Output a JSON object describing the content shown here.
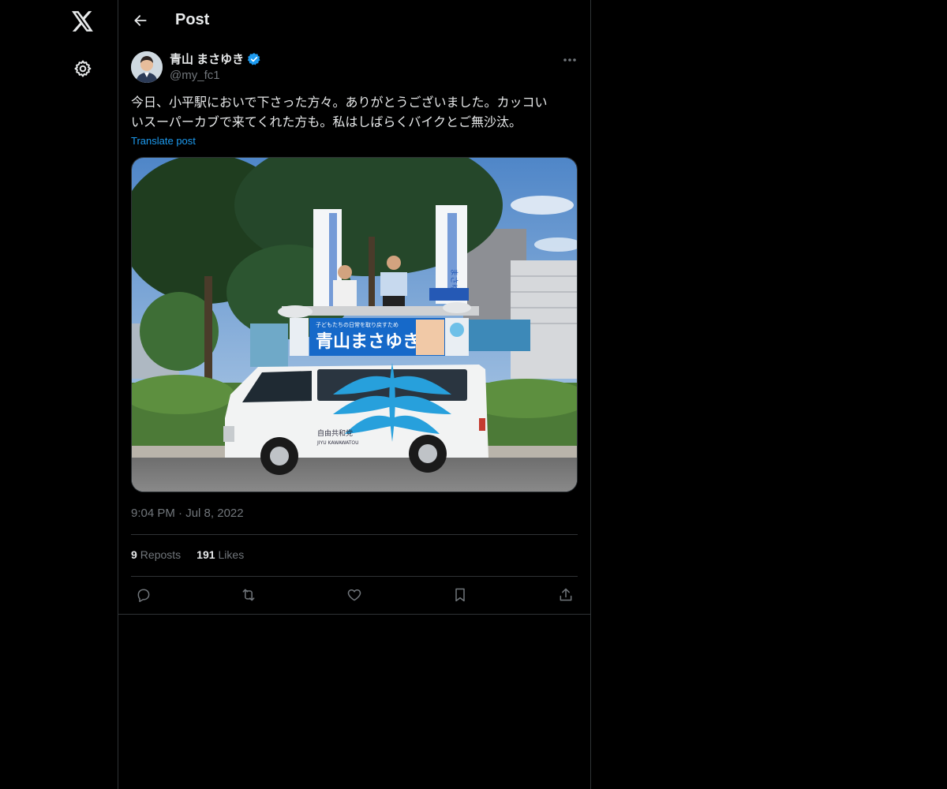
{
  "nav": {
    "items": [
      {
        "icon": "x-logo-icon"
      },
      {
        "icon": "gear-icon"
      }
    ]
  },
  "header": {
    "title": "Post",
    "back_icon": "arrow-left-icon"
  },
  "post": {
    "author_name": "青山 まさゆき",
    "verified": true,
    "handle": "@my_fc1",
    "text_line1": "今日、小平駅においで下さった方々。ありがとうございました。カッコい",
    "text_line2": "いスーパーカブで来てくれた方も。私はしばらくバイクとご無沙汰。",
    "translate_label": "Translate post",
    "image": {
      "banner_name": "青山まさゆき",
      "banner_sub": "子どもたちの日常を取り戻すため",
      "party": "自由共和党",
      "party_en": "JIYU KAWAWATOU",
      "flag_text": "まさゆき"
    },
    "time": "9:04 PM",
    "date": "Jul 8, 2022",
    "reposts_count": "9",
    "reposts_label": "Reposts",
    "likes_count": "191",
    "likes_label": "Likes",
    "actions": [
      "reply-icon",
      "repost-icon",
      "like-icon",
      "bookmark-icon",
      "share-icon"
    ]
  },
  "colors": {
    "accent": "#1d9bf0",
    "muted": "#71767b",
    "border": "#2f3336"
  }
}
